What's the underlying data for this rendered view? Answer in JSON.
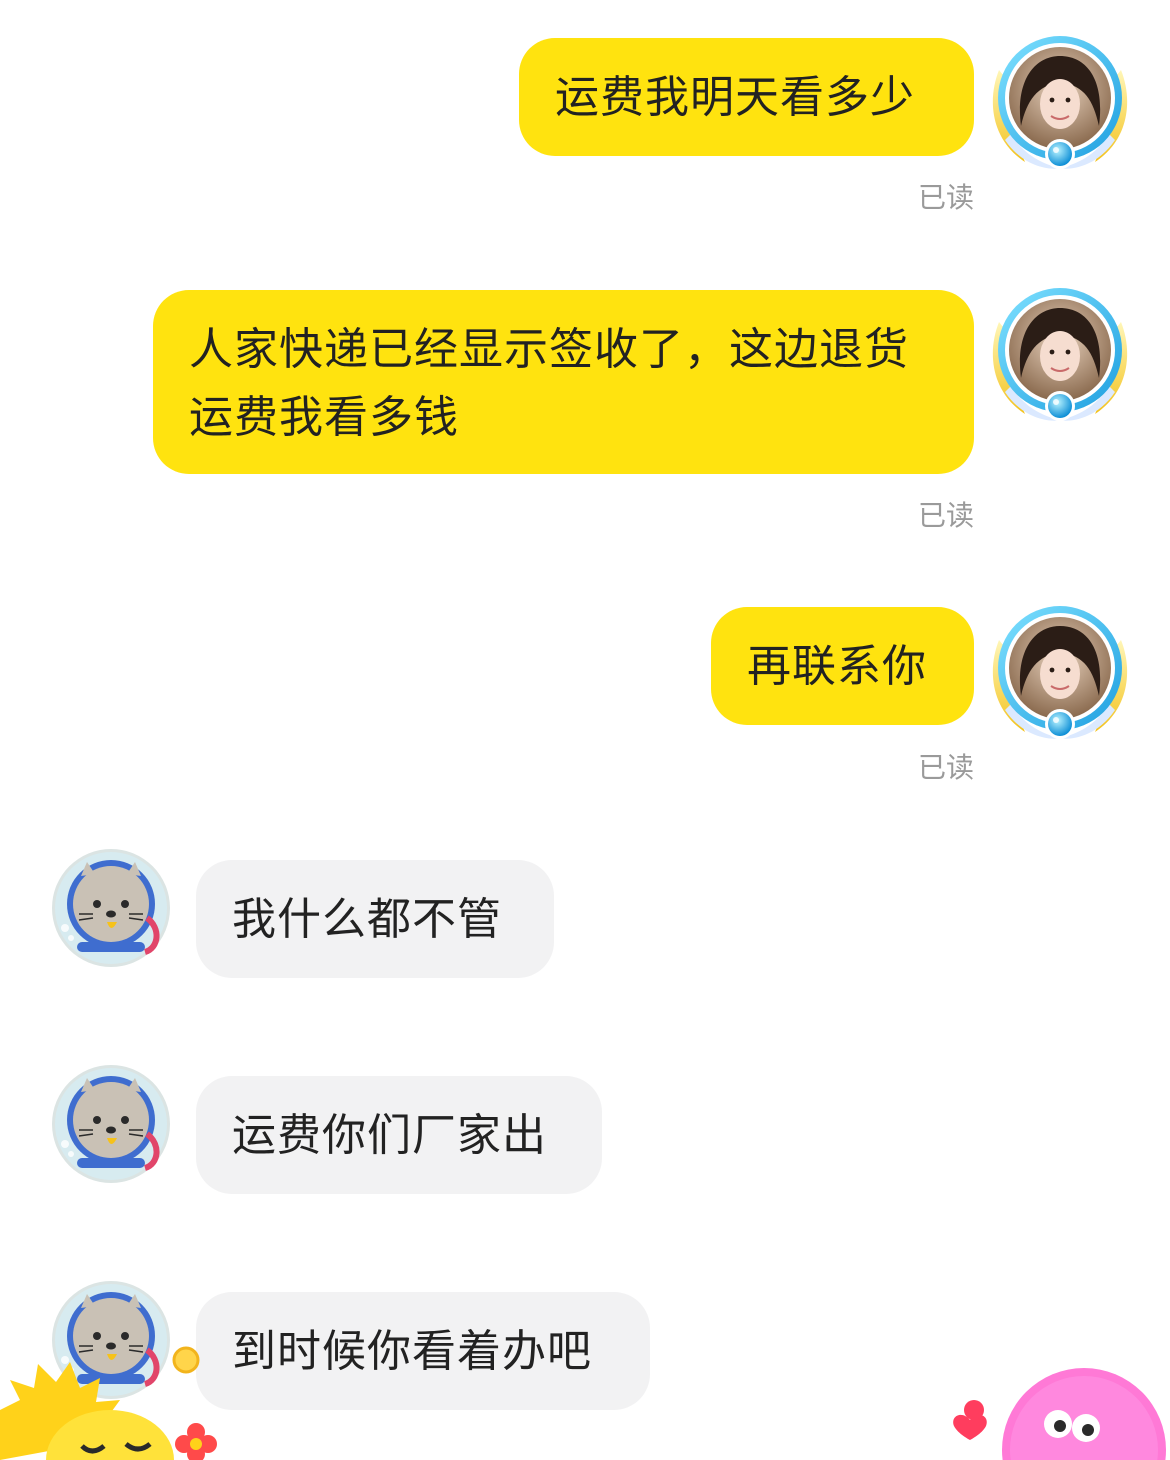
{
  "conversation": {
    "messages": [
      {
        "id": "m1",
        "direction": "outgoing",
        "text": "运费我明天看多少",
        "status": "已读"
      },
      {
        "id": "m2",
        "direction": "outgoing",
        "text": "人家快递已经显示签收了，这边退货运费我看多钱",
        "status": "已读"
      },
      {
        "id": "m3",
        "direction": "outgoing",
        "text": "再联系你",
        "status": "已读"
      },
      {
        "id": "m4",
        "direction": "incoming",
        "text": "我什么都不管"
      },
      {
        "id": "m5",
        "direction": "incoming",
        "text": "运费你们厂家出"
      },
      {
        "id": "m6",
        "direction": "incoming",
        "text": "到时候你看着办吧"
      }
    ]
  },
  "colors": {
    "outgoing_bubble": "#ffe30f",
    "incoming_bubble": "#f2f2f3",
    "read_status": "#9a9a9a",
    "avatar_frame": "#29b7f0"
  },
  "icons": {
    "self_avatar": "woman-portrait-with-winged-frame",
    "other_avatar": "seal-astronaut",
    "bottom_left_decor": "yellow-chick-sticker",
    "bottom_right_decor": "pink-monster-sticker"
  }
}
